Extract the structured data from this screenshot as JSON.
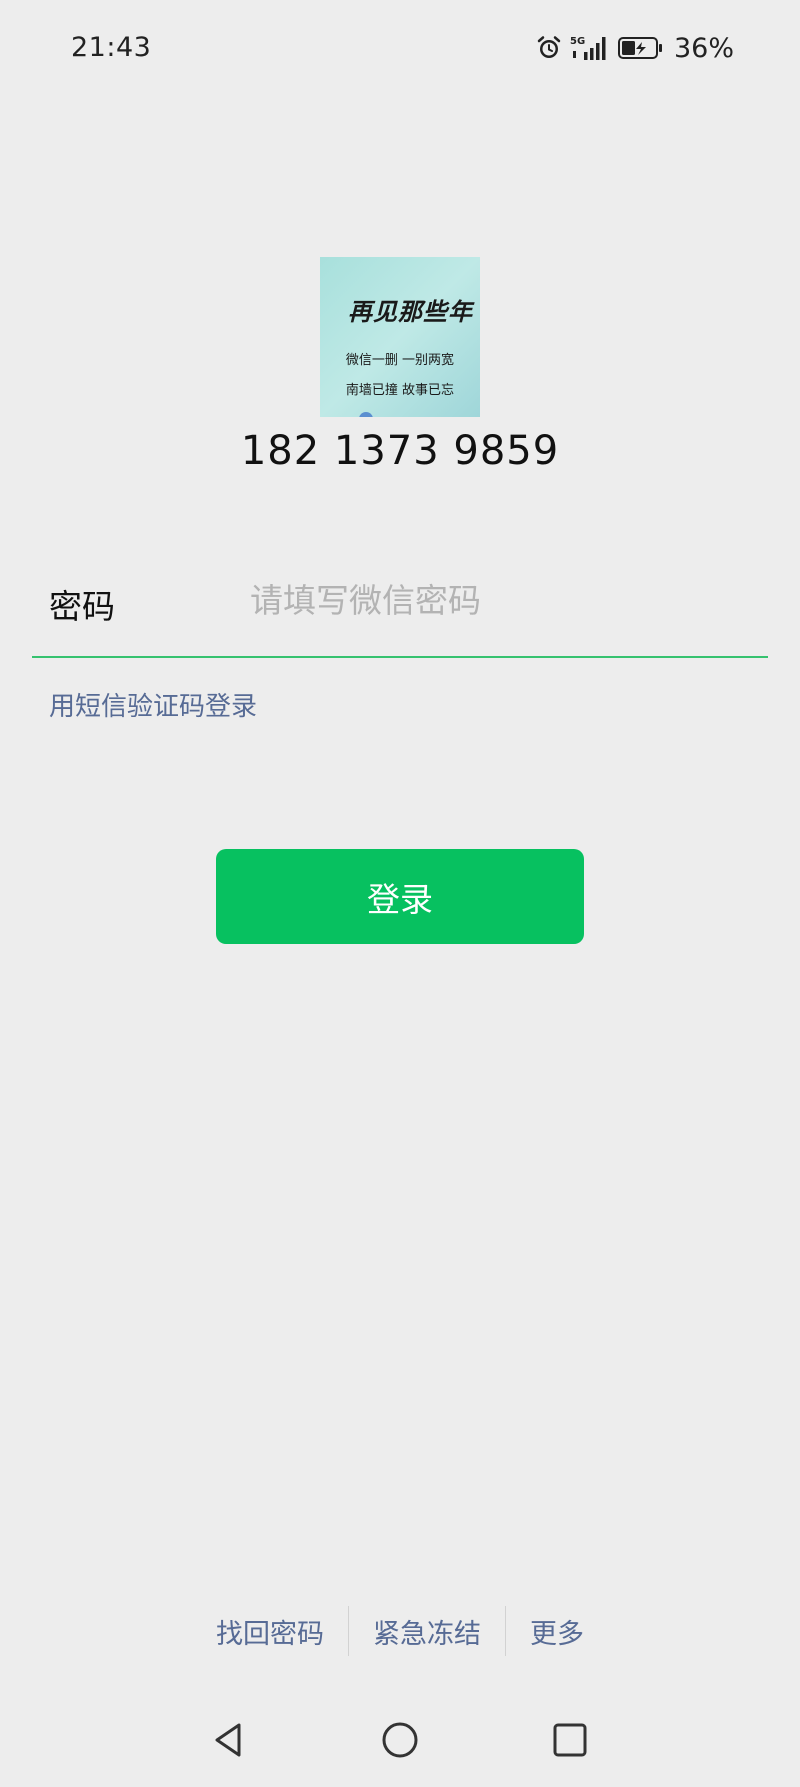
{
  "status_bar": {
    "time": "21:43",
    "network": "5G",
    "battery_percent": "36%",
    "icons": [
      "alarm-icon",
      "signal-icon",
      "battery-icon"
    ]
  },
  "account": {
    "avatar_text": {
      "calligraphy": "再见那些年",
      "line1": "微信一删 一别两宽",
      "line2": "南墙已撞 故事已忘"
    },
    "phone_number": "182 1373 9859"
  },
  "password": {
    "label": "密码",
    "placeholder": "请填写微信密码",
    "value": ""
  },
  "sms_login_link": "用短信验证码登录",
  "login_button": "登录",
  "bottom_links": {
    "retrieve_password": "找回密码",
    "emergency_freeze": "紧急冻结",
    "more": "更多"
  },
  "colors": {
    "background": "#ededed",
    "primary_green": "#07c160",
    "link_blue": "#576b95",
    "underline_green": "#36c26f"
  }
}
